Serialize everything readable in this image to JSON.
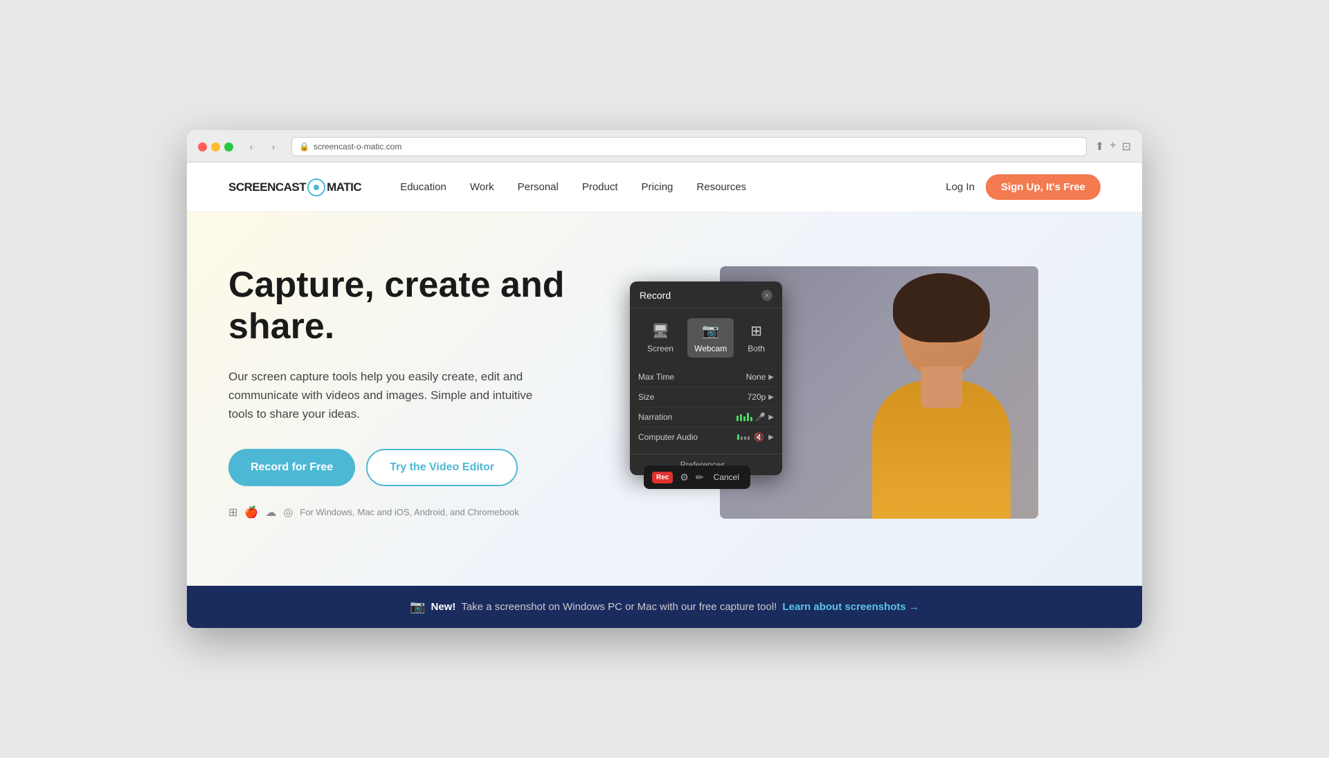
{
  "browser": {
    "url": "screencast-o-matic.com",
    "tab_icon": "🛡"
  },
  "navbar": {
    "logo_text_left": "SCREENCAST",
    "logo_text_right": "MATIC",
    "nav_items": [
      {
        "label": "Education",
        "id": "education"
      },
      {
        "label": "Work",
        "id": "work"
      },
      {
        "label": "Personal",
        "id": "personal"
      },
      {
        "label": "Product",
        "id": "product"
      },
      {
        "label": "Pricing",
        "id": "pricing"
      },
      {
        "label": "Resources",
        "id": "resources"
      }
    ],
    "login_label": "Log In",
    "signup_label": "Sign Up, It's Free"
  },
  "hero": {
    "title": "Capture, create and share.",
    "subtitle": "Our screen capture tools help you easily create, edit and communicate with videos and images. Simple and intuitive tools to share your ideas.",
    "record_btn": "Record for Free",
    "editor_btn": "Try the Video Editor",
    "platform_text": "For Windows, Mac and iOS, Android, and Chromebook"
  },
  "record_dialog": {
    "title": "Record",
    "close_icon": "×",
    "modes": [
      {
        "label": "Screen",
        "icon": "🖥",
        "active": false
      },
      {
        "label": "Webcam",
        "icon": "📷",
        "active": true
      },
      {
        "label": "Both",
        "icon": "⊞",
        "active": false
      }
    ],
    "settings": [
      {
        "label": "Max Time",
        "value": "None",
        "has_arrow": true
      },
      {
        "label": "Size",
        "value": "720p",
        "has_arrow": true
      },
      {
        "label": "Narration",
        "value": "",
        "has_bars": true,
        "has_arrow": true
      },
      {
        "label": "Computer Audio",
        "value": "",
        "has_comp": true,
        "has_arrow": true
      }
    ],
    "preferences_label": "Preferences..."
  },
  "record_toolbar": {
    "rec_label": "Rec",
    "cancel_label": "Cancel"
  },
  "banner": {
    "camera_icon": "📷",
    "new_label": "New!",
    "text": " Take a screenshot on Windows PC or Mac with our free capture tool!",
    "link_text": "Learn about screenshots →"
  }
}
